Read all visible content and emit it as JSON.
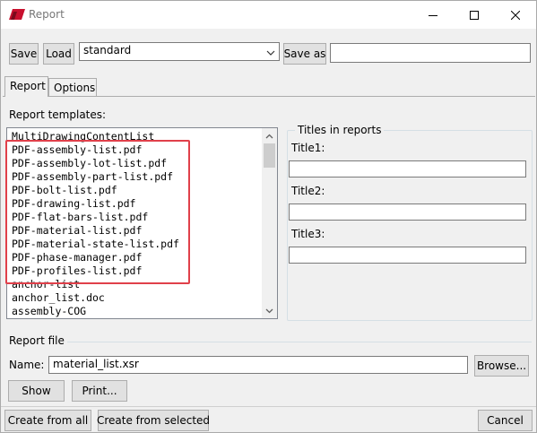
{
  "window": {
    "title": "Report",
    "colors": {
      "accent_red": "#c8102e",
      "highlight": "#e0404a"
    }
  },
  "toolbar": {
    "save_label": "Save",
    "load_label": "Load",
    "attribute_set_value": "standard",
    "save_as_label": "Save as",
    "save_as_value": ""
  },
  "tabs": [
    {
      "label": "Report"
    },
    {
      "label": "Options"
    }
  ],
  "templates": {
    "label": "Report templates:",
    "items": [
      "MultiDrawingContentList",
      "PDF-assembly-list.pdf",
      "PDF-assembly-lot-list.pdf",
      "PDF-assembly-part-list.pdf",
      "PDF-bolt-list.pdf",
      "PDF-drawing-list.pdf",
      "PDF-flat-bars-list.pdf",
      "PDF-material-list.pdf",
      "PDF-material-state-list.pdf",
      "PDF-phase-manager.pdf",
      "PDF-profiles-list.pdf",
      "anchor-list",
      "anchor_list.doc",
      "assembly-COG"
    ]
  },
  "titles": {
    "legend": "Titles in reports",
    "title1_label": "Title1:",
    "title1_value": "",
    "title2_label": "Title2:",
    "title2_value": "",
    "title3_label": "Title3:",
    "title3_value": ""
  },
  "report_file": {
    "section_label": "Report file",
    "name_label": "Name:",
    "name_value": "material_list.xsr",
    "browse_label": "Browse...",
    "show_label": "Show",
    "print_label": "Print..."
  },
  "footer": {
    "create_all_label": "Create from all",
    "create_selected_label": "Create from selected",
    "cancel_label": "Cancel"
  }
}
